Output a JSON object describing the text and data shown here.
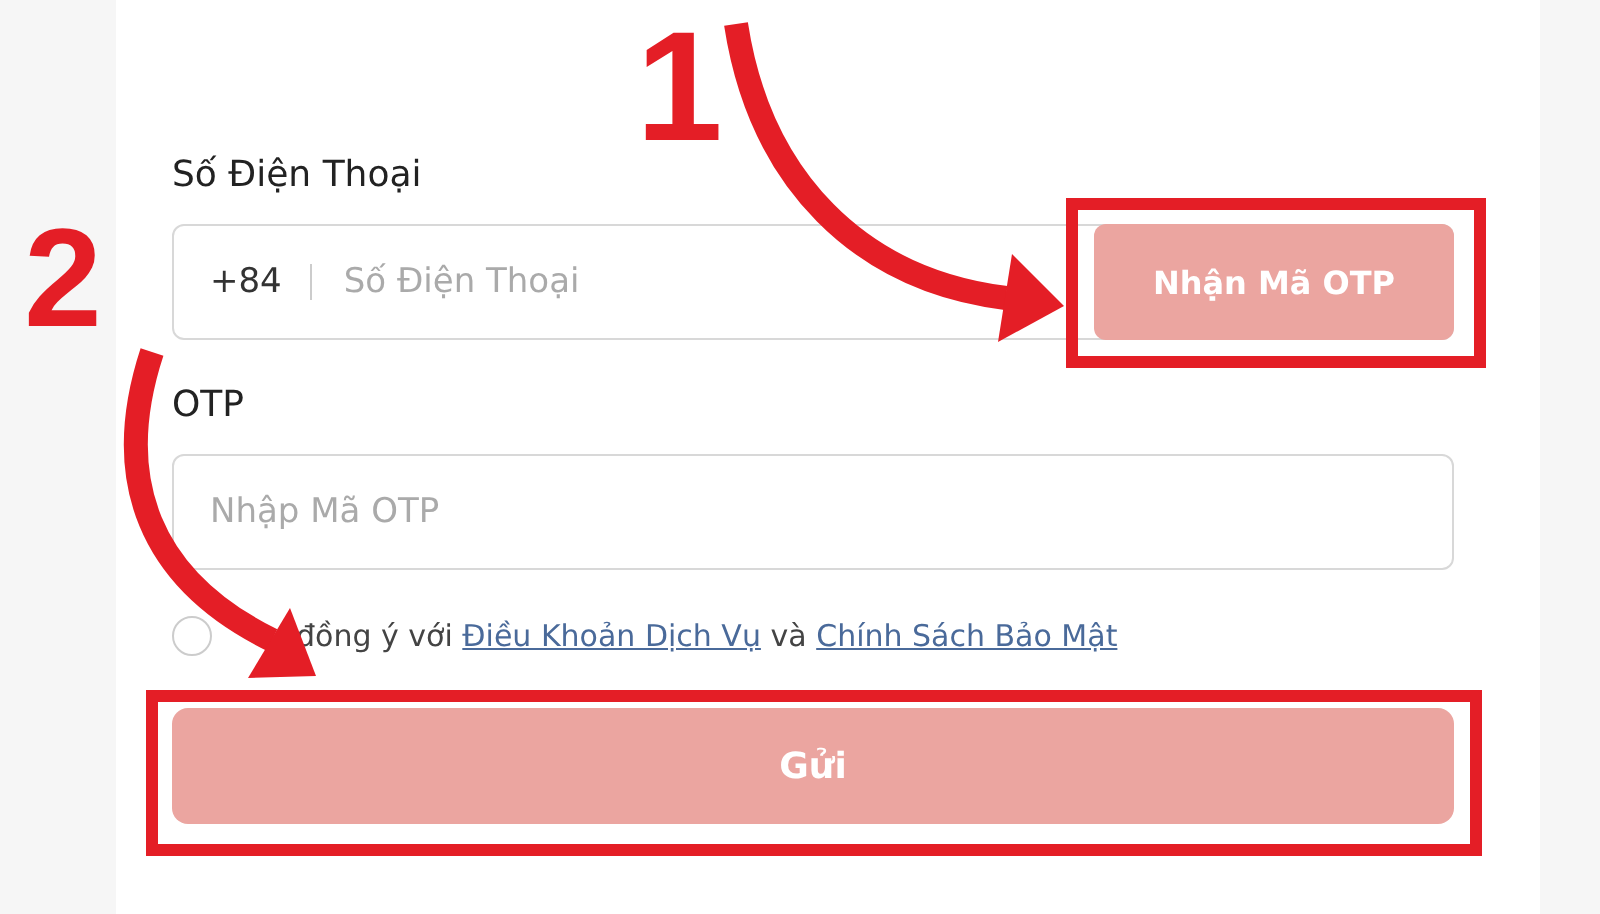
{
  "phone": {
    "label": "Số Điện Thoại",
    "prefix": "+84",
    "placeholder": "Số Điện Thoại",
    "button": "Nhận Mã OTP"
  },
  "otp": {
    "label": "OTP",
    "placeholder": "Nhập Mã OTP"
  },
  "agreement": {
    "checked": false,
    "parts": [
      {
        "kind": "text",
        "text": "đồng ý với"
      },
      {
        "kind": "link",
        "text": "Điều Khoản Dịch Vụ"
      },
      {
        "kind": "text",
        "text": "và"
      },
      {
        "kind": "link",
        "text": "Chính Sách Bảo Mật"
      }
    ]
  },
  "submit": "Gửi",
  "annotations": [
    {
      "number": "1"
    },
    {
      "number": "2"
    }
  ]
}
